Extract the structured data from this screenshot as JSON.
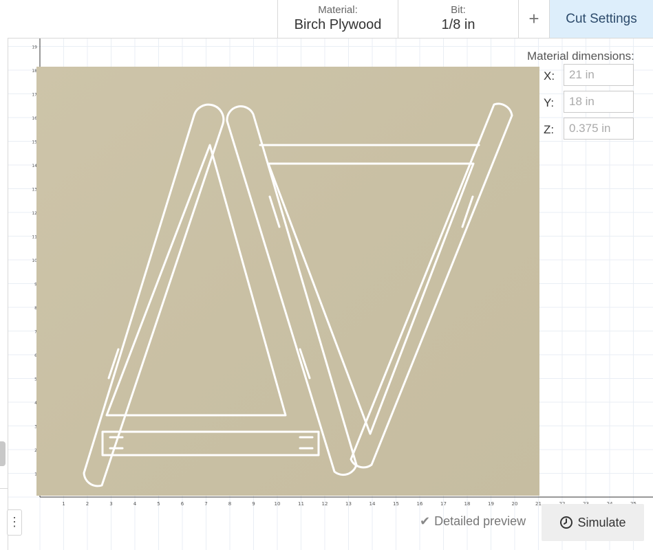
{
  "toolbar": {
    "material_label": "Material:",
    "material_value": "Birch Plywood",
    "bit_label": "Bit:",
    "bit_value": "1/8 in",
    "add_glyph": "+",
    "cut_settings_label": "Cut Settings"
  },
  "material_dimensions": {
    "title": "Material dimensions:",
    "x_label": "X:",
    "x_value": "21 in",
    "y_label": "Y:",
    "y_value": "18 in",
    "z_label": "Z:",
    "z_value": "0.375 in"
  },
  "ruler": {
    "x_ticks": [
      "1",
      "2",
      "3",
      "4",
      "5",
      "6",
      "7",
      "8",
      "9",
      "10",
      "11",
      "12",
      "13",
      "14",
      "15",
      "16",
      "17",
      "18",
      "19",
      "20",
      "21",
      "22",
      "23",
      "24",
      "25"
    ],
    "y_ticks": [
      "1",
      "2",
      "3",
      "4",
      "5",
      "6",
      "7",
      "8",
      "9",
      "10",
      "11",
      "12",
      "13",
      "14",
      "15",
      "16",
      "17",
      "18",
      "19"
    ]
  },
  "footer": {
    "more_glyph": "⋮",
    "detailed_preview_label": "Detailed preview",
    "simulate_label": "Simulate"
  },
  "icons": {
    "clock": "clock-icon",
    "check": "check-icon",
    "more": "more-vertical-icon"
  },
  "colors": {
    "cut_settings_bg": "#ddeefb",
    "wood": "#cbc2a8",
    "grid": "#e9eef4"
  }
}
